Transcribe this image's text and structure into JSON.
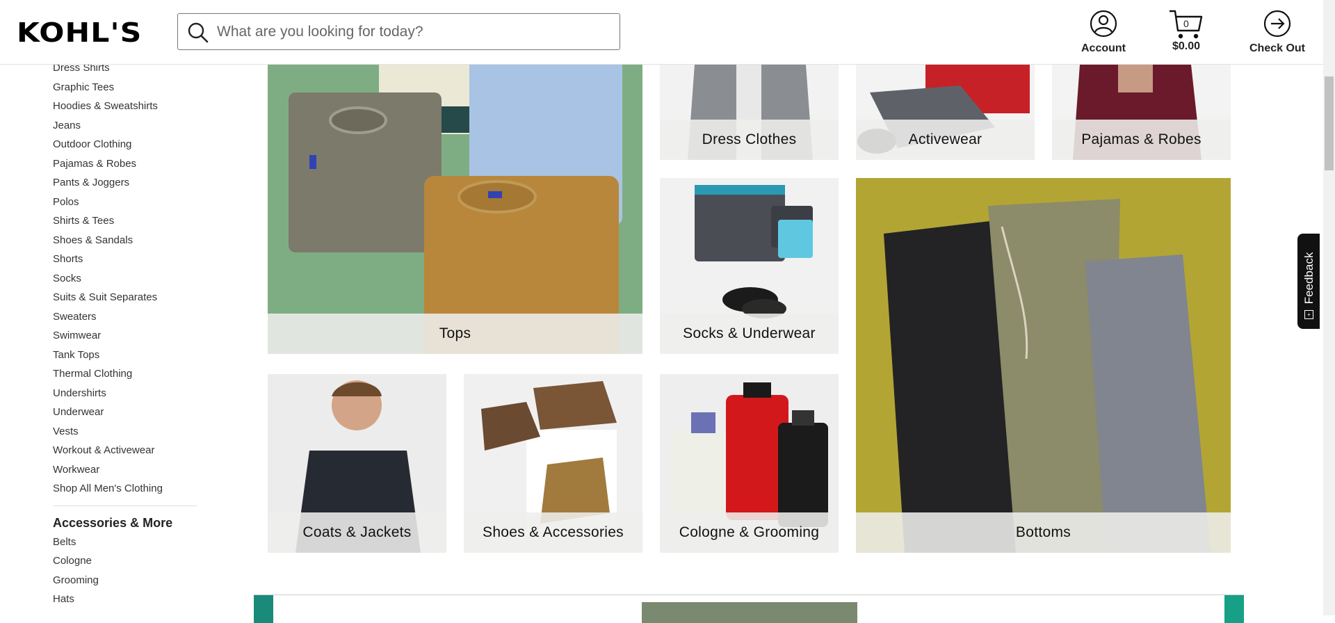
{
  "header": {
    "logo": "KOHL'S",
    "search_placeholder": "What are you looking for today?",
    "account_label": "Account",
    "cart_count": "0",
    "cart_total": "$0.00",
    "checkout_label": "Check Out"
  },
  "sidebar": {
    "items": [
      "Dress Shirts",
      "Graphic Tees",
      "Hoodies & Sweatshirts",
      "Jeans",
      "Outdoor Clothing",
      "Pajamas & Robes",
      "Pants & Joggers",
      "Polos",
      "Shirts & Tees",
      "Shoes & Sandals",
      "Shorts",
      "Socks",
      "Suits & Suit Separates",
      "Sweaters",
      "Swimwear",
      "Tank Tops",
      "Thermal Clothing",
      "Undershirts",
      "Underwear",
      "Vests",
      "Workout & Activewear",
      "Workwear",
      "Shop All Men's Clothing"
    ],
    "accessories_heading": "Accessories & More",
    "accessories_items": [
      "Belts",
      "Cologne",
      "Grooming",
      "Hats"
    ]
  },
  "tiles": {
    "dress_clothes": "Dress Clothes",
    "activewear": "Activewear",
    "pajamas_robes": "Pajamas & Robes",
    "tops": "Tops",
    "socks_underwear": "Socks & Underwear",
    "bottoms": "Bottoms",
    "coats_jackets": "Coats & Jackets",
    "shoes_accessories": "Shoes & Accessories",
    "cologne_grooming": "Cologne & Grooming"
  },
  "feedback": {
    "label": "Feedback"
  },
  "colors": {
    "tops_bg": "#7fad83",
    "bottoms_bg": "#b3a534",
    "banner_left": "#1a8a7a",
    "banner_right": "#16a085"
  }
}
